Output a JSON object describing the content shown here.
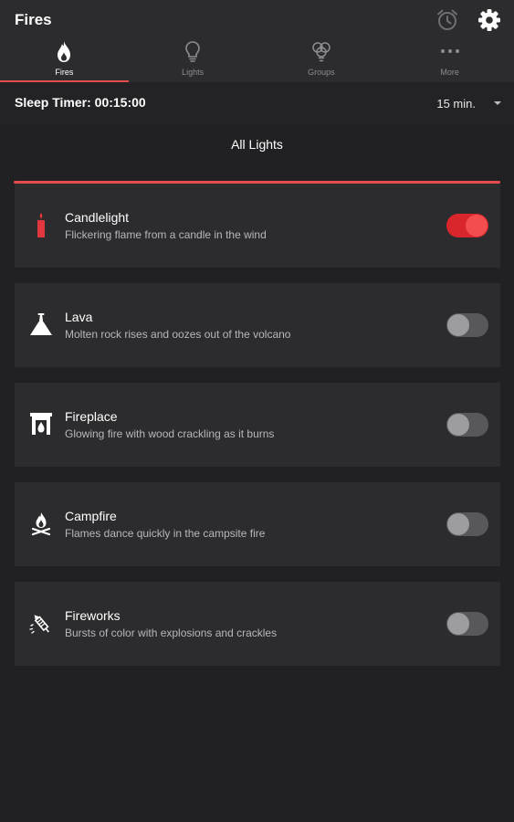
{
  "app": {
    "title": "Fires"
  },
  "header_icons": [
    "alarm-clock-icon",
    "gear-icon"
  ],
  "tabs": [
    {
      "label": "Fires",
      "icon": "flame-icon",
      "active": true
    },
    {
      "label": "Lights",
      "icon": "lightbulb-icon",
      "active": false
    },
    {
      "label": "Groups",
      "icon": "bulb-group-icon",
      "active": false
    },
    {
      "label": "More",
      "icon": "more-dots-icon",
      "active": false
    }
  ],
  "sleep_timer": {
    "label": "Sleep Timer: 00:15:00",
    "selected": "15 min."
  },
  "section_title": "All Lights",
  "items": [
    {
      "name": "Candlelight",
      "description": "Flickering flame from a candle in the wind",
      "icon": "candle-icon",
      "enabled": true
    },
    {
      "name": "Lava",
      "description": "Molten rock rises and oozes out of the volcano",
      "icon": "volcano-icon",
      "enabled": false
    },
    {
      "name": "Fireplace",
      "description": "Glowing fire with wood crackling as it burns",
      "icon": "fireplace-icon",
      "enabled": false
    },
    {
      "name": "Campfire",
      "description": "Flames dance quickly in the campsite fire",
      "icon": "campfire-icon",
      "enabled": false
    },
    {
      "name": "Fireworks",
      "description": "Bursts of color with explosions and crackles",
      "icon": "firework-rocket-icon",
      "enabled": false
    }
  ],
  "colors": {
    "accent": "#e64c4c",
    "toggle_on": "#f24d4f",
    "background": "#212123",
    "card": "#2c2c2e"
  }
}
